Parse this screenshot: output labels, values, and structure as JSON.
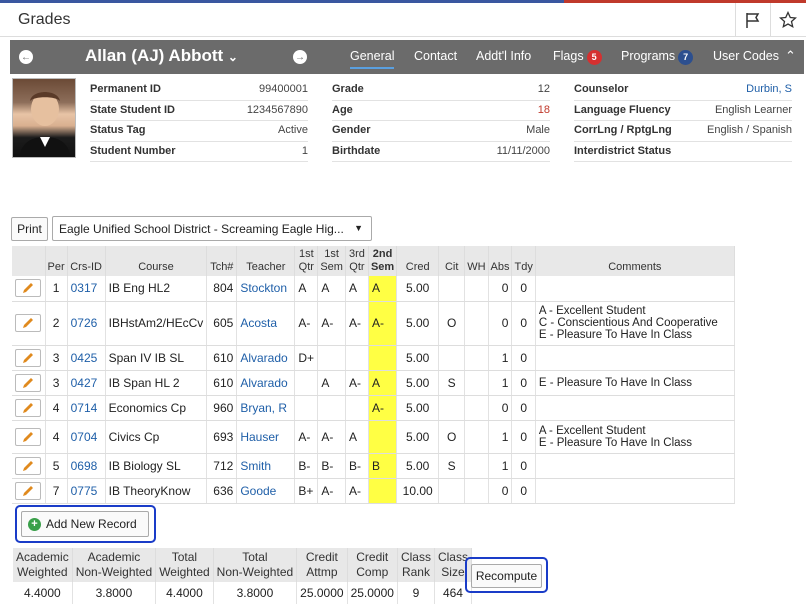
{
  "page_title": "Grades",
  "student": {
    "name": "Allan (AJ) Abbott"
  },
  "nav_tabs": [
    {
      "label": "General",
      "active": true
    },
    {
      "label": "Contact"
    },
    {
      "label": "Addt'l Info"
    },
    {
      "label": "Flags",
      "badge": "5",
      "badge_color": "#d63030"
    },
    {
      "label": "Programs",
      "badge": "7",
      "badge_color": "#2c4f8f"
    },
    {
      "label": "User Codes"
    }
  ],
  "info": {
    "col1": [
      {
        "label": "Permanent ID",
        "value": "99400001"
      },
      {
        "label": "State Student ID",
        "value": "1234567890"
      },
      {
        "label": "Status Tag",
        "value": "Active"
      },
      {
        "label": "Student Number",
        "value": "1"
      }
    ],
    "col2": [
      {
        "label": "Grade",
        "value": "12"
      },
      {
        "label": "Age",
        "value": "18"
      },
      {
        "label": "Gender",
        "value": "Male"
      },
      {
        "label": "Birthdate",
        "value": "11/11/2000"
      }
    ],
    "col3": [
      {
        "label": "Counselor",
        "value": "Durbin, S"
      },
      {
        "label": "Language Fluency",
        "value": "English Learner"
      },
      {
        "label": "CorrLng / RptgLng",
        "value": "English / Spanish"
      },
      {
        "label": "Interdistrict Status",
        "value": ""
      }
    ]
  },
  "print_label": "Print",
  "school_select": "Eagle Unified School District - Screaming Eagle Hig...",
  "grades_table": {
    "headers": [
      "Per",
      "Crs-ID",
      "Course",
      "Tch#",
      "Teacher",
      "1st Qtr",
      "1st Sem",
      "3rd Qtr",
      "2nd Sem",
      "Cred",
      "Cit",
      "WH",
      "Abs",
      "Tdy",
      "Comments"
    ],
    "rows": [
      {
        "per": "1",
        "crs": "0317",
        "course": "IB Eng HL2",
        "tch": "804",
        "teacher": "Stockton",
        "q1": "A",
        "s1": "A",
        "q3": "A",
        "s2": "A",
        "cred": "5.00",
        "cit": "",
        "wh": "",
        "abs": "0",
        "tdy": "0",
        "comments": ""
      },
      {
        "per": "2",
        "crs": "0726",
        "course": "IBHstAm2/HEcCv",
        "tch": "605",
        "teacher": "Acosta",
        "q1": "A-",
        "s1": "A-",
        "q3": "A-",
        "s2": "A-",
        "cred": "5.00",
        "cit": "O",
        "wh": "",
        "abs": "0",
        "tdy": "0",
        "comments": "A - Excellent Student\nC - Conscientious And Cooperative\nE - Pleasure To Have In Class"
      },
      {
        "per": "3",
        "crs": "0425",
        "course": "Span IV IB SL",
        "tch": "610",
        "teacher": "Alvarado",
        "q1": "D+",
        "s1": "",
        "q3": "",
        "s2": "",
        "cred": "5.00",
        "cit": "",
        "wh": "",
        "abs": "1",
        "tdy": "0",
        "comments": ""
      },
      {
        "per": "3",
        "crs": "0427",
        "course": "IB Span HL 2",
        "tch": "610",
        "teacher": "Alvarado",
        "q1": "",
        "s1": "A",
        "q3": "A-",
        "s2": "A",
        "cred": "5.00",
        "cit": "S",
        "wh": "",
        "abs": "1",
        "tdy": "0",
        "comments": "E - Pleasure To Have In Class"
      },
      {
        "per": "4",
        "crs": "0714",
        "course": "Economics Cp",
        "tch": "960",
        "teacher": "Bryan, R",
        "q1": "",
        "s1": "",
        "q3": "",
        "s2": "A-",
        "cred": "5.00",
        "cit": "",
        "wh": "",
        "abs": "0",
        "tdy": "0",
        "comments": ""
      },
      {
        "per": "4",
        "crs": "0704",
        "course": "Civics Cp",
        "tch": "693",
        "teacher": "Hauser",
        "q1": "A-",
        "s1": "A-",
        "q3": "A",
        "s2": "",
        "cred": "5.00",
        "cit": "O",
        "wh": "",
        "abs": "1",
        "tdy": "0",
        "comments": "A - Excellent Student\nE - Pleasure To Have In Class"
      },
      {
        "per": "5",
        "crs": "0698",
        "course": "IB Biology SL",
        "tch": "712",
        "teacher": "Smith",
        "q1": "B-",
        "s1": "B-",
        "q3": "B-",
        "s2": "B",
        "cred": "5.00",
        "cit": "S",
        "wh": "",
        "abs": "1",
        "tdy": "0",
        "comments": ""
      },
      {
        "per": "7",
        "crs": "0775",
        "course": "IB TheoryKnow",
        "tch": "636",
        "teacher": "Goode",
        "q1": "B+",
        "s1": "A-",
        "q3": "A-",
        "s2": "",
        "cred": "10.00",
        "cit": "",
        "wh": "",
        "abs": "0",
        "tdy": "0",
        "comments": ""
      }
    ]
  },
  "add_record_label": "Add New Record",
  "summary": {
    "headers": [
      "Academic Weighted",
      "Academic Non-Weighted",
      "Total Weighted",
      "Total Non-Weighted",
      "Credit Attmp",
      "Credit Comp",
      "Class Rank",
      "Class Size"
    ],
    "values": [
      "4.4000",
      "3.8000",
      "4.4000",
      "3.8000",
      "25.0000",
      "25.0000",
      "9",
      "464"
    ]
  },
  "recompute_label": "Recompute",
  "colors": {
    "highlight": "#ffff44",
    "link": "#1f5fa8",
    "focus_outline": "#1a3cc8",
    "navbar": "#6b6b6b"
  }
}
